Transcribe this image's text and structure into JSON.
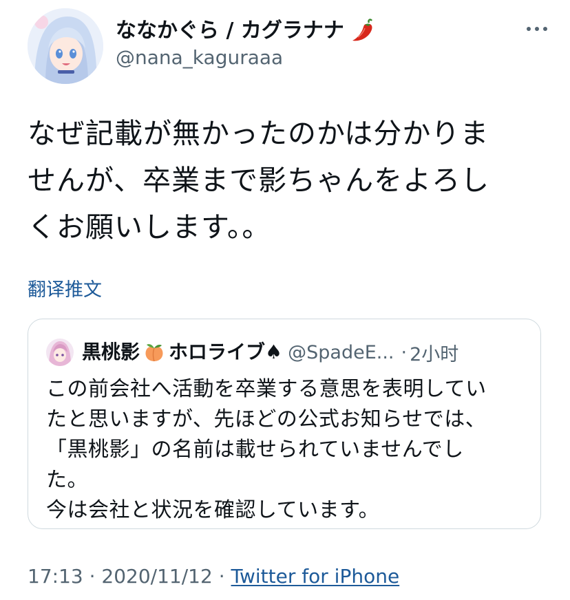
{
  "author": {
    "display_name": "ななかぐら / カグラナナ",
    "display_name_emoji": "hot-pepper",
    "handle": "@nana_kaguraaa",
    "avatar_icon": "anime-girl-avatar"
  },
  "more_icon": "ellipsis-icon",
  "tweet": {
    "lines": [
      "なぜ記載が無かったのかは分かりま",
      "せんが、卒業まで影ちゃんをよろし",
      "くお願いします。。"
    ]
  },
  "translate_label": "翻译推文",
  "quoted": {
    "name": "黒桃影",
    "name_emoji": "peach",
    "name_suffix": "ホロライブ♠",
    "handle": "@SpadeE...",
    "separator": "·",
    "time": "2小时",
    "lines": [
      "この前会社へ活動を卒業する意思を表明してい",
      "たと思いますが、先ほどの公式お知らせでは、",
      "「黒桃影」の名前は載せられていませんでし",
      "た。",
      "今は会社と状況を確認しています。"
    ]
  },
  "footer": {
    "time": "17:13",
    "separator1": "·",
    "date": "2020/11/12",
    "separator2": "·",
    "source": "Twitter for iPhone"
  },
  "colors": {
    "text": "#0f1419",
    "secondary": "#536471",
    "link": "#1d5a99",
    "border": "#cfd9de"
  }
}
